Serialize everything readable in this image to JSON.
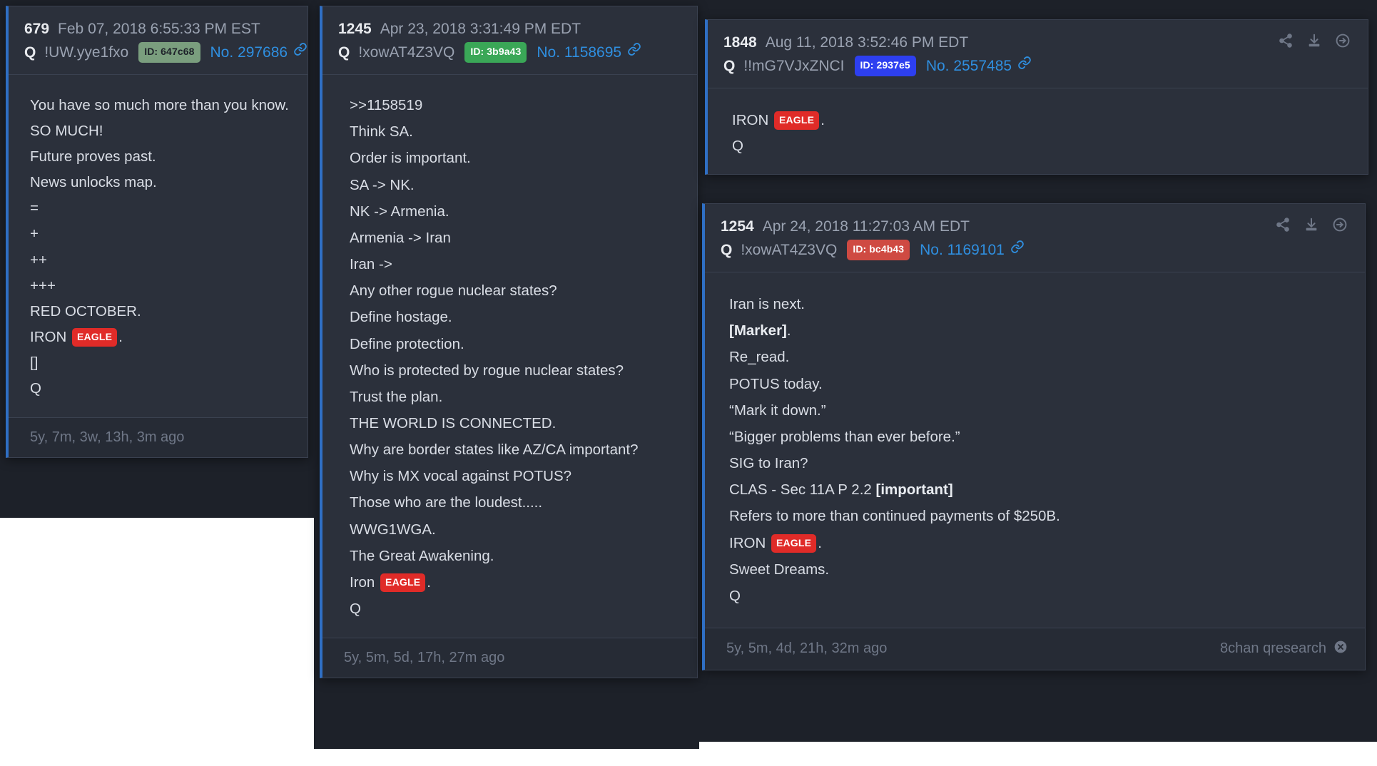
{
  "cards": [
    {
      "key": "679",
      "post_number": "679",
      "date": "Feb 07, 2018 6:55:33 PM EST",
      "q_label": "Q",
      "tripcode": "!UW.yye1fxo",
      "id_badge": "ID: 647c68",
      "id_color": "#7a9e7e",
      "post_link": "No. 297686",
      "link_icon": "chain-icon",
      "lines": [
        "You have so much more than you know.",
        "SO MUCH!",
        "Future proves past.",
        "News unlocks map.",
        "=",
        "+",
        "++",
        "+++",
        "RED OCTOBER.",
        "IRON [EAGLE].",
        "[]",
        "Q"
      ],
      "ago": "5y, 7m, 3w, 13h, 3m ago",
      "source": ""
    },
    {
      "key": "1245",
      "post_number": "1245",
      "date": "Apr 23, 2018 3:31:49 PM EDT",
      "q_label": "Q",
      "tripcode": "!xowAT4Z3VQ",
      "id_badge": "ID: 3b9a43",
      "id_color": "#3aa757",
      "post_link": "No. 1158695",
      "link_icon": "chain-icon",
      "lines": [
        ">>1158519",
        "Think SA.",
        "Order is important.",
        "SA -> NK.",
        "NK -> Armenia.",
        "Armenia -> Iran",
        "Iran ->",
        "Any other rogue nuclear states?",
        "Define hostage.",
        "Define protection.",
        "Who is protected by rogue nuclear states?",
        "Trust the plan.",
        "THE WORLD IS CONNECTED.",
        "Why are border states like AZ/CA important?",
        "Why is MX vocal against POTUS?",
        "Those who are the loudest.....",
        "WWG1WGA.",
        "The Great Awakening.",
        "Iron [EAGLE].",
        "Q"
      ],
      "ago": "5y, 5m, 5d, 17h, 27m ago",
      "source": ""
    },
    {
      "key": "1848",
      "post_number": "1848",
      "date": "Aug 11, 2018 3:52:46 PM EDT",
      "q_label": "Q",
      "tripcode": "!!mG7VJxZNCI",
      "id_badge": "ID: 2937e5",
      "id_color": "#2d3ff0",
      "post_link": "No. 2557485",
      "link_icon": "chain-icon",
      "icons": [
        "share-icon",
        "download-icon",
        "arrow-right-circle-icon"
      ],
      "lines": [
        "IRON [EAGLE].",
        "Q"
      ],
      "ago": "",
      "source": ""
    },
    {
      "key": "1254",
      "post_number": "1254",
      "date": "Apr 24, 2018 11:27:03 AM EDT",
      "q_label": "Q",
      "tripcode": "!xowAT4Z3VQ",
      "id_badge": "ID: bc4b43",
      "id_color": "#cf4a42",
      "post_link": "No. 1169101",
      "link_icon": "chain-icon",
      "icons": [
        "share-icon",
        "download-icon",
        "arrow-right-circle-icon"
      ],
      "lines": [
        "Iran is next.",
        "**[Marker]**.",
        "Re_read.",
        "POTUS today.",
        "“Mark it down.”",
        "“Bigger problems than ever before.”",
        "SIG to Iran?",
        "CLAS - Sec 11A P 2.2 **[important]**",
        "Refers to more than continued payments of $250B.",
        "IRON [EAGLE].",
        "Sweet Dreams.",
        "Q"
      ],
      "ago": "5y, 5m, 4d, 21h, 32m ago",
      "source": "8chan qresearch",
      "close_icon": "close-circle-icon"
    }
  ],
  "colors": {
    "card_bg": "#2b303b",
    "card_border": "#3a4150",
    "accent_left": "#2f6fc4",
    "link": "#2f8fe0",
    "eagle_red": "#e02b28",
    "text": "#d9dde5",
    "muted": "#6f7787",
    "page_bg": "#1d2129"
  }
}
